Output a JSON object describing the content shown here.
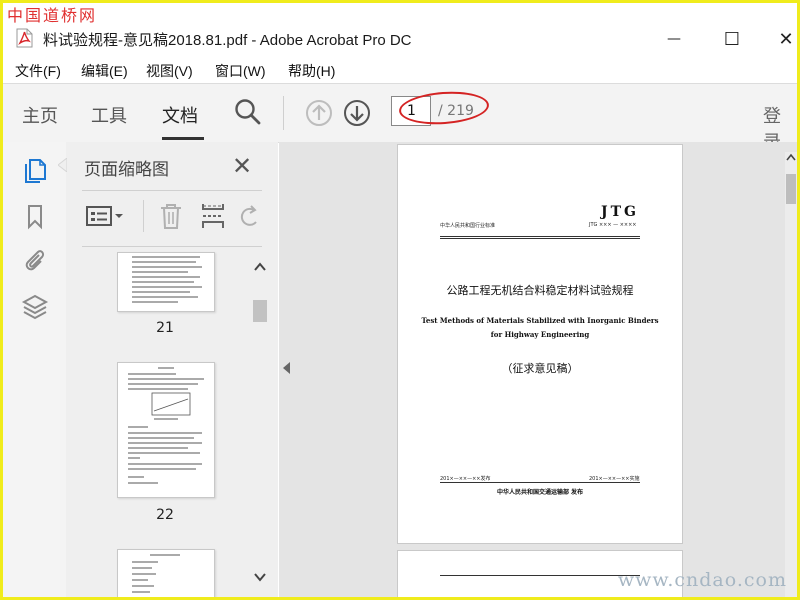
{
  "watermarks": {
    "top_left": "中国道桥网",
    "bottom_right": "www.cndao.com"
  },
  "window": {
    "title": "料试验规程-意见稿2018.81.pdf - Adobe Acrobat Pro DC",
    "controls": {
      "minimize": "—",
      "maximize": "☐",
      "close": "✕"
    }
  },
  "menu": [
    "文件(F)",
    "编辑(E)",
    "视图(V)",
    "窗口(W)",
    "帮助(H)"
  ],
  "toolbar": {
    "tabs": [
      {
        "label": "主页",
        "active": false
      },
      {
        "label": "工具",
        "active": false
      },
      {
        "label": "文档",
        "active": true
      }
    ],
    "page_current": "1",
    "page_total": "/ 219",
    "login": "登录"
  },
  "left_rail": {
    "icons": [
      "page-thumbnails-icon",
      "bookmark-icon",
      "attachment-icon",
      "layers-icon"
    ]
  },
  "thumbnails_panel": {
    "title": "页面缩略图",
    "close": "✕",
    "tools": [
      "thumbnail-options-icon",
      "delete-page-icon",
      "insert-page-icon",
      "rotate-page-icon"
    ],
    "pages": [
      {
        "number": "21"
      },
      {
        "number": "22"
      },
      {
        "number": ""
      }
    ]
  },
  "document_page": {
    "code": "JTG",
    "header_left": "中华人民共和国行业标准",
    "header_right": "JTG ××× — ××××",
    "title_cn": "公路工程无机结合料稳定材料试验规程",
    "title_en_line1": "Test Methods of Materials Stabilized with Inorganic Binders",
    "title_en_line2": "for Highway Engineering",
    "draft_note": "（征求意见稿）",
    "issue_date": "201×—××—××发布",
    "effective_date": "201×—××—××实施",
    "publisher": "中华人民共和国交通运输部  发布"
  },
  "colors": {
    "frame_border": "#f0ec1c",
    "annotation_circle": "#d42323",
    "watermark_red": "#e03030",
    "pdf_icon_red": "#d8262b"
  }
}
